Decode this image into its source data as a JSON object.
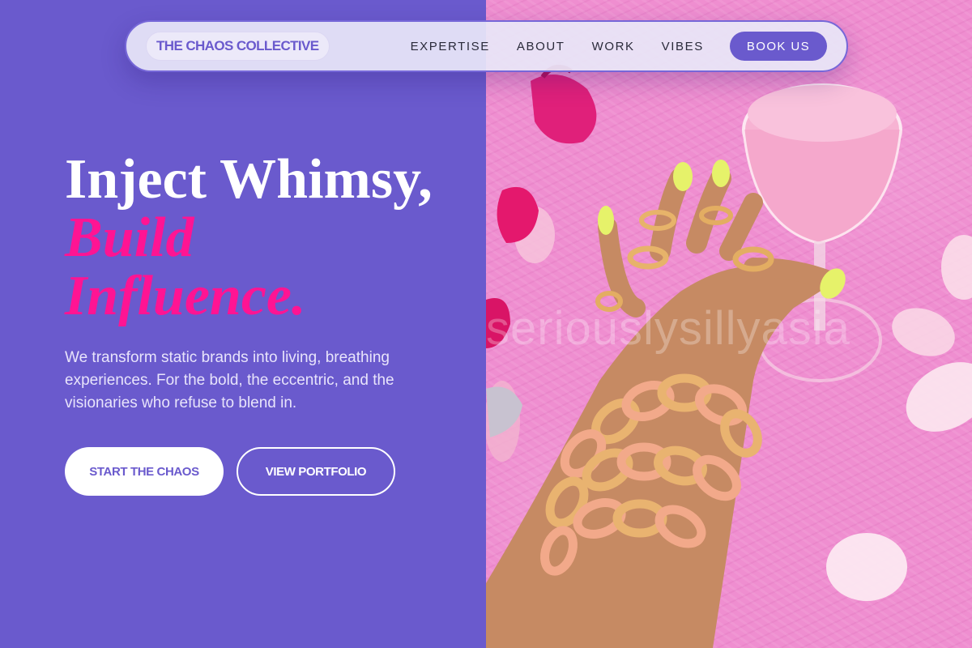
{
  "nav": {
    "brand": "THE CHAOS COLLECTIVE",
    "links": [
      "EXPERTISE",
      "ABOUT",
      "WORK",
      "VIBES"
    ],
    "cta": "BOOK US"
  },
  "hero": {
    "title_line1": "Inject Whimsy,",
    "title_line2": "Build",
    "title_line3": "Influence.",
    "description": "We transform static brands into living, breathing experiences. For the bold, the eccentric, and the visionaries who refuse to blend in.",
    "primary_button": "START THE CHAOS",
    "secondary_button": "VIEW PORTFOLIO"
  },
  "image": {
    "watermark": "seriouslysillyasia",
    "description_icon": "photo-hand-gold-chains-pink-drink"
  },
  "colors": {
    "purple": "#6a5acd",
    "pink_accent": "#ff1493",
    "fur_pink": "#ef8ed0"
  }
}
